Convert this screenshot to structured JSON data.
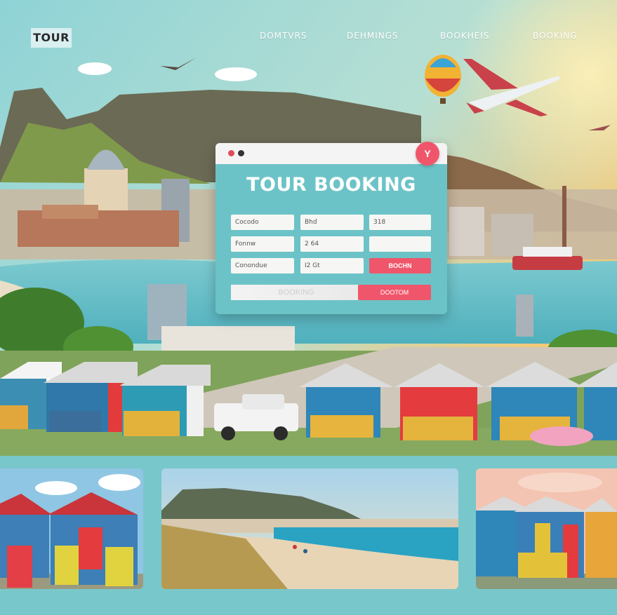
{
  "nav": {
    "logo": "TOUR",
    "links": [
      "DOMTVRS",
      "DEHMINGS",
      "BOOKHEIS",
      "BOOKING"
    ]
  },
  "booking": {
    "close_label": "Y",
    "title": "TOUR BOOKING",
    "fields": [
      [
        "Cocodo",
        "Bhd",
        "318"
      ],
      [
        "Fonnw",
        "2 64",
        ""
      ],
      [
        "Conondue",
        "I2 Gt",
        ""
      ]
    ],
    "book_label": "BOCHN",
    "bottom_input": "BOOKING",
    "submit_label": "DOOTOM"
  },
  "colors": {
    "accent": "#f0566b",
    "panel": "#6cc3c7",
    "background": "#78c7cb"
  }
}
